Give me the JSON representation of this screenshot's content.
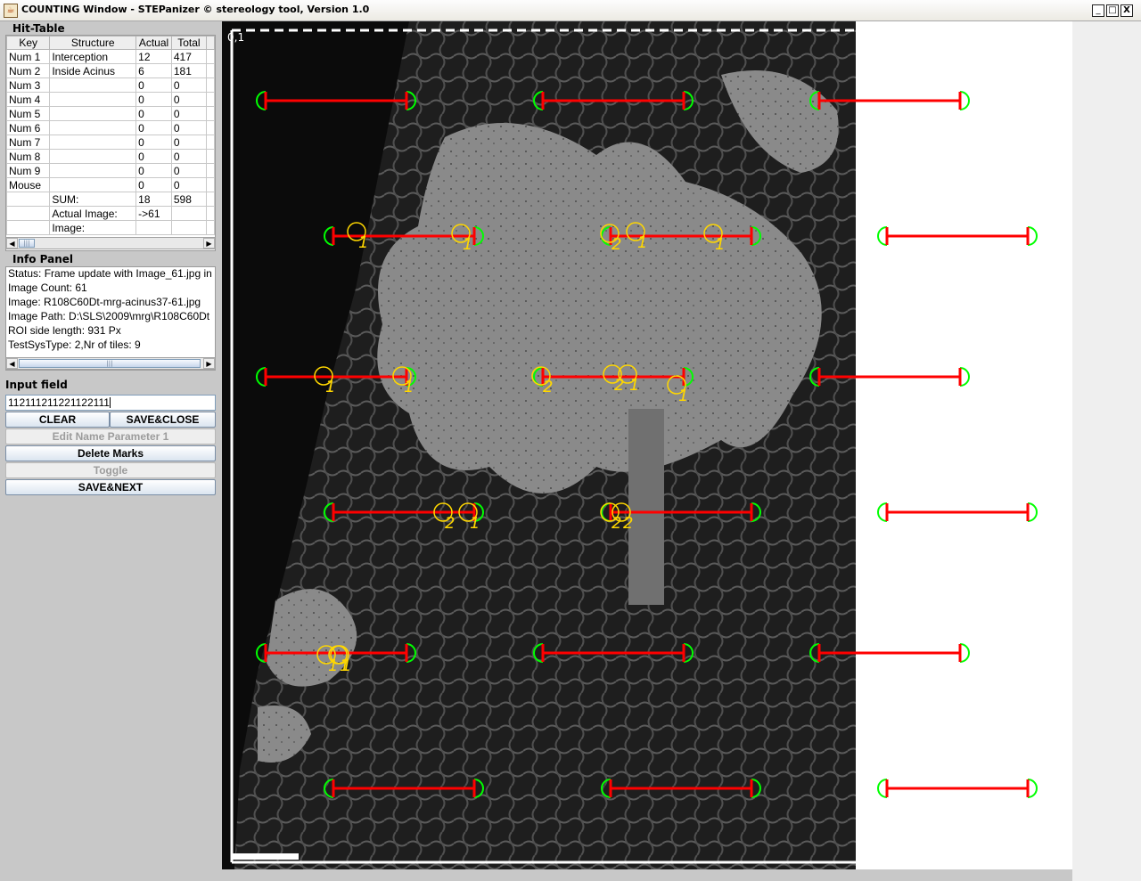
{
  "window": {
    "title": "COUNTING Window - STEPanizer © stereology tool, Version 1.0",
    "icon": "java-cup-icon",
    "controls": [
      "_",
      "□",
      "X"
    ]
  },
  "hit_table": {
    "title": "Hit-Table",
    "columns": [
      "Key",
      "Structure",
      "Actual",
      "Total"
    ],
    "rows": [
      [
        "Num 1",
        "Interception",
        "12",
        "417"
      ],
      [
        "Num 2",
        "Inside Acinus",
        "6",
        "181"
      ],
      [
        "Num 3",
        "",
        "0",
        "0"
      ],
      [
        "Num 4",
        "",
        "0",
        "0"
      ],
      [
        "Num 5",
        "",
        "0",
        "0"
      ],
      [
        "Num 6",
        "",
        "0",
        "0"
      ],
      [
        "Num 7",
        "",
        "0",
        "0"
      ],
      [
        "Num 8",
        "",
        "0",
        "0"
      ],
      [
        "Num 9",
        "",
        "0",
        "0"
      ],
      [
        "Mouse",
        "",
        "0",
        "0"
      ],
      [
        "",
        "SUM:",
        "18",
        "598"
      ],
      [
        "",
        "Actual Image:",
        "->61",
        ""
      ],
      [
        "",
        "Image:",
        "",
        ""
      ]
    ]
  },
  "info_panel": {
    "title": "Info Panel",
    "lines": [
      "Status: Frame update with Image_61.jpg in",
      "Image Count: 61",
      "Image: R108C60Dt-mrg-acinus37-61.jpg",
      "Image Path: D:\\SLS\\2009\\mrg\\R108C60Dt",
      "ROI side length: 931 Px",
      "TestSysType: 2,Nr of tiles: 9"
    ]
  },
  "input": {
    "label": "Input field",
    "value": "112111211221122111"
  },
  "buttons": {
    "clear": "CLEAR",
    "save_close": "SAVE&CLOSE",
    "edit_name": "Edit Name Parameter 1",
    "delete_marks": "Delete Marks",
    "toggle": "Toggle",
    "save_next": "SAVE&NEXT"
  },
  "canvas": {
    "corner_label": "0,1",
    "colors": {
      "test_line": "#ff0000",
      "endpoint": "#00ff00",
      "hit_marker": "#ffd700",
      "frame": "#ffffff"
    },
    "hit_labels": [
      "1",
      "1",
      "2",
      "1",
      "1",
      "1",
      "1",
      "2",
      "2",
      "1",
      "1",
      "2",
      "1",
      "2",
      "2",
      "1",
      "1",
      "1"
    ]
  }
}
